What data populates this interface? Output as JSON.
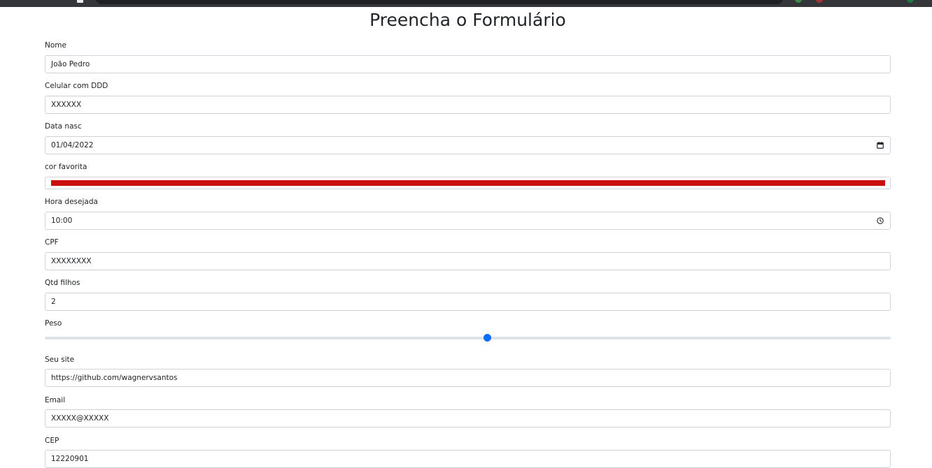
{
  "page": {
    "title": "Preencha o Formulário"
  },
  "form": {
    "nome": {
      "label": "Nome",
      "value": "João Pedro"
    },
    "celular": {
      "label": "Celular com DDD",
      "value": "XXXXXX"
    },
    "data_nasc": {
      "label": "Data nasc",
      "value": "01/04/2022",
      "icon": "calendar-icon"
    },
    "cor_favorita": {
      "label": "cor favorita",
      "value": "#cc0e0e"
    },
    "hora": {
      "label": "Hora desejada",
      "value": "10:00",
      "icon": "clock-icon"
    },
    "cpf": {
      "label": "CPF",
      "value": "XXXXXXXX"
    },
    "qtd_filhos": {
      "label": "Qtd filhos",
      "value": "2"
    },
    "peso": {
      "label": "Peso",
      "value_fraction": 0.523
    },
    "site": {
      "label": "Seu site",
      "value": "https://github.com/wagnervsantos"
    },
    "email": {
      "label": "Email",
      "value": "XXXXX@XXXXX"
    },
    "cep": {
      "label": "CEP",
      "value": "12220901"
    }
  },
  "colors": {
    "accent": "#0d6efd",
    "border": "#ced4da",
    "track": "#dee2e6",
    "text": "#212529"
  }
}
